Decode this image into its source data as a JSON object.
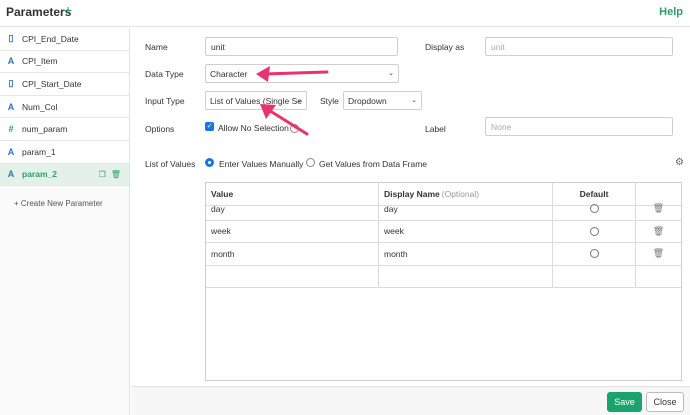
{
  "header": {
    "title": "Parameters",
    "add_icon": "plus-icon",
    "help_label": "Help"
  },
  "sidebar": {
    "items": [
      {
        "icon": "calendar-icon",
        "icon_glyph": "▯",
        "label": "CPI_End_Date"
      },
      {
        "icon": "character-icon",
        "icon_glyph": "A",
        "label": "CPI_Item"
      },
      {
        "icon": "calendar-icon",
        "icon_glyph": "▯",
        "label": "CPI_Start_Date"
      },
      {
        "icon": "character-icon",
        "icon_glyph": "A",
        "label": "Num_Col"
      },
      {
        "icon": "numeric-icon",
        "icon_glyph": "#",
        "label": "num_param"
      },
      {
        "icon": "character-icon",
        "icon_glyph": "A",
        "label": "param_1"
      },
      {
        "icon": "character-icon",
        "icon_glyph": "A",
        "label": "param_2",
        "active": true
      }
    ],
    "create_label": "+ Create New Parameter"
  },
  "form": {
    "name_label": "Name",
    "name_value": "unit",
    "display_as_label": "Display as",
    "display_as_placeholder": "unit",
    "data_type_label": "Data Type",
    "data_type_value": "Character",
    "input_type_label": "Input Type",
    "input_type_value": "List of Values (Single Se",
    "style_label": "Style",
    "style_value": "Dropdown",
    "options_label": "Options",
    "allow_no_selection_label": "Allow No Selection",
    "allow_no_selection_checked": true,
    "label_label": "Label",
    "label_placeholder": "None",
    "list_of_values_label": "List of Values",
    "radio_manual_label": "Enter Values Manually",
    "radio_frame_label": "Get Values from Data Frame",
    "selected_source": "manual"
  },
  "table": {
    "col_value": "Value",
    "col_display": "Display Name",
    "col_display_optional": "(Optional)",
    "col_default": "Default",
    "rows": [
      {
        "value": "day",
        "display": "day"
      },
      {
        "value": "week",
        "display": "week"
      },
      {
        "value": "month",
        "display": "month"
      }
    ]
  },
  "footer": {
    "save_label": "Save",
    "close_label": "Close"
  },
  "colors": {
    "accent": "#2f9d6a",
    "save_bg": "#1aa36f",
    "checkbox": "#1a73e8",
    "arrow": "#e8336e"
  }
}
